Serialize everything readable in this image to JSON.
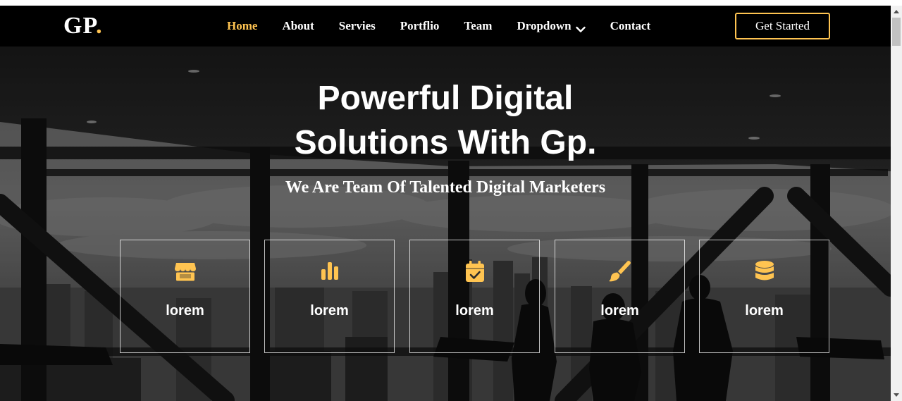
{
  "header": {
    "logo_text": "GP",
    "logo_dot": ".",
    "nav": [
      {
        "label": "Home",
        "active": true
      },
      {
        "label": "About",
        "active": false
      },
      {
        "label": "Servies",
        "active": false
      },
      {
        "label": "Portflio",
        "active": false
      },
      {
        "label": "Team",
        "active": false
      },
      {
        "label": "Dropdown",
        "active": false
      },
      {
        "label": "Contact",
        "active": false
      }
    ],
    "cta_label": "Get Started"
  },
  "hero": {
    "title_line1": "Powerful Digital",
    "title_line2": "Solutions With Gp.",
    "subtitle": "We Are Team Of Talented Digital Marketers"
  },
  "boxes": [
    {
      "icon": "store-icon",
      "label": "lorem"
    },
    {
      "icon": "bar-chart-icon",
      "label": "lorem"
    },
    {
      "icon": "calendar-check-icon",
      "label": "lorem"
    },
    {
      "icon": "paint-brush-icon",
      "label": "lorem"
    },
    {
      "icon": "database-icon",
      "label": "lorem"
    }
  ],
  "colors": {
    "accent": "#ffc451",
    "header_bg": "#000000",
    "text": "#ffffff"
  }
}
